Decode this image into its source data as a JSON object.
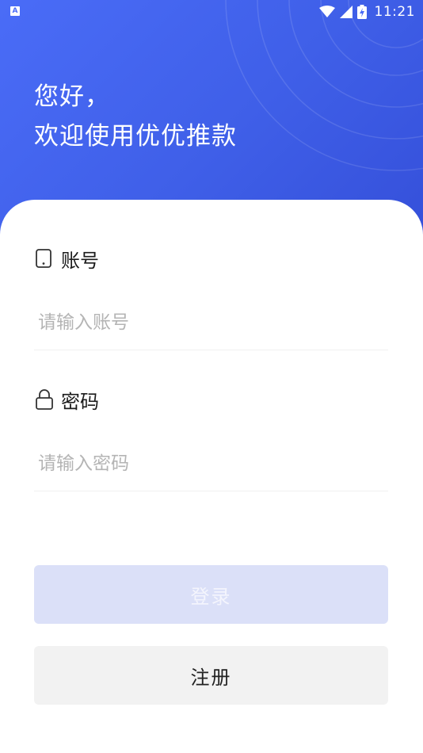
{
  "status_bar": {
    "left_icon": "A",
    "time": "11:21",
    "icons": [
      "wifi-icon",
      "signal-icon",
      "battery-charging-icon"
    ]
  },
  "greeting": {
    "line1": "您好，",
    "line2": "欢迎使用优优推款"
  },
  "form": {
    "account": {
      "label": "账号",
      "icon": "phone-icon",
      "placeholder": "请输入账号",
      "value": ""
    },
    "password": {
      "label": "密码",
      "icon": "lock-icon",
      "placeholder": "请输入密码",
      "value": ""
    }
  },
  "buttons": {
    "login_label": "登录",
    "register_label": "注册"
  },
  "colors": {
    "header_start": "#4a6cf7",
    "header_end": "#3550da",
    "login_disabled_bg": "#dbe0f8",
    "register_bg": "#f2f2f2"
  }
}
